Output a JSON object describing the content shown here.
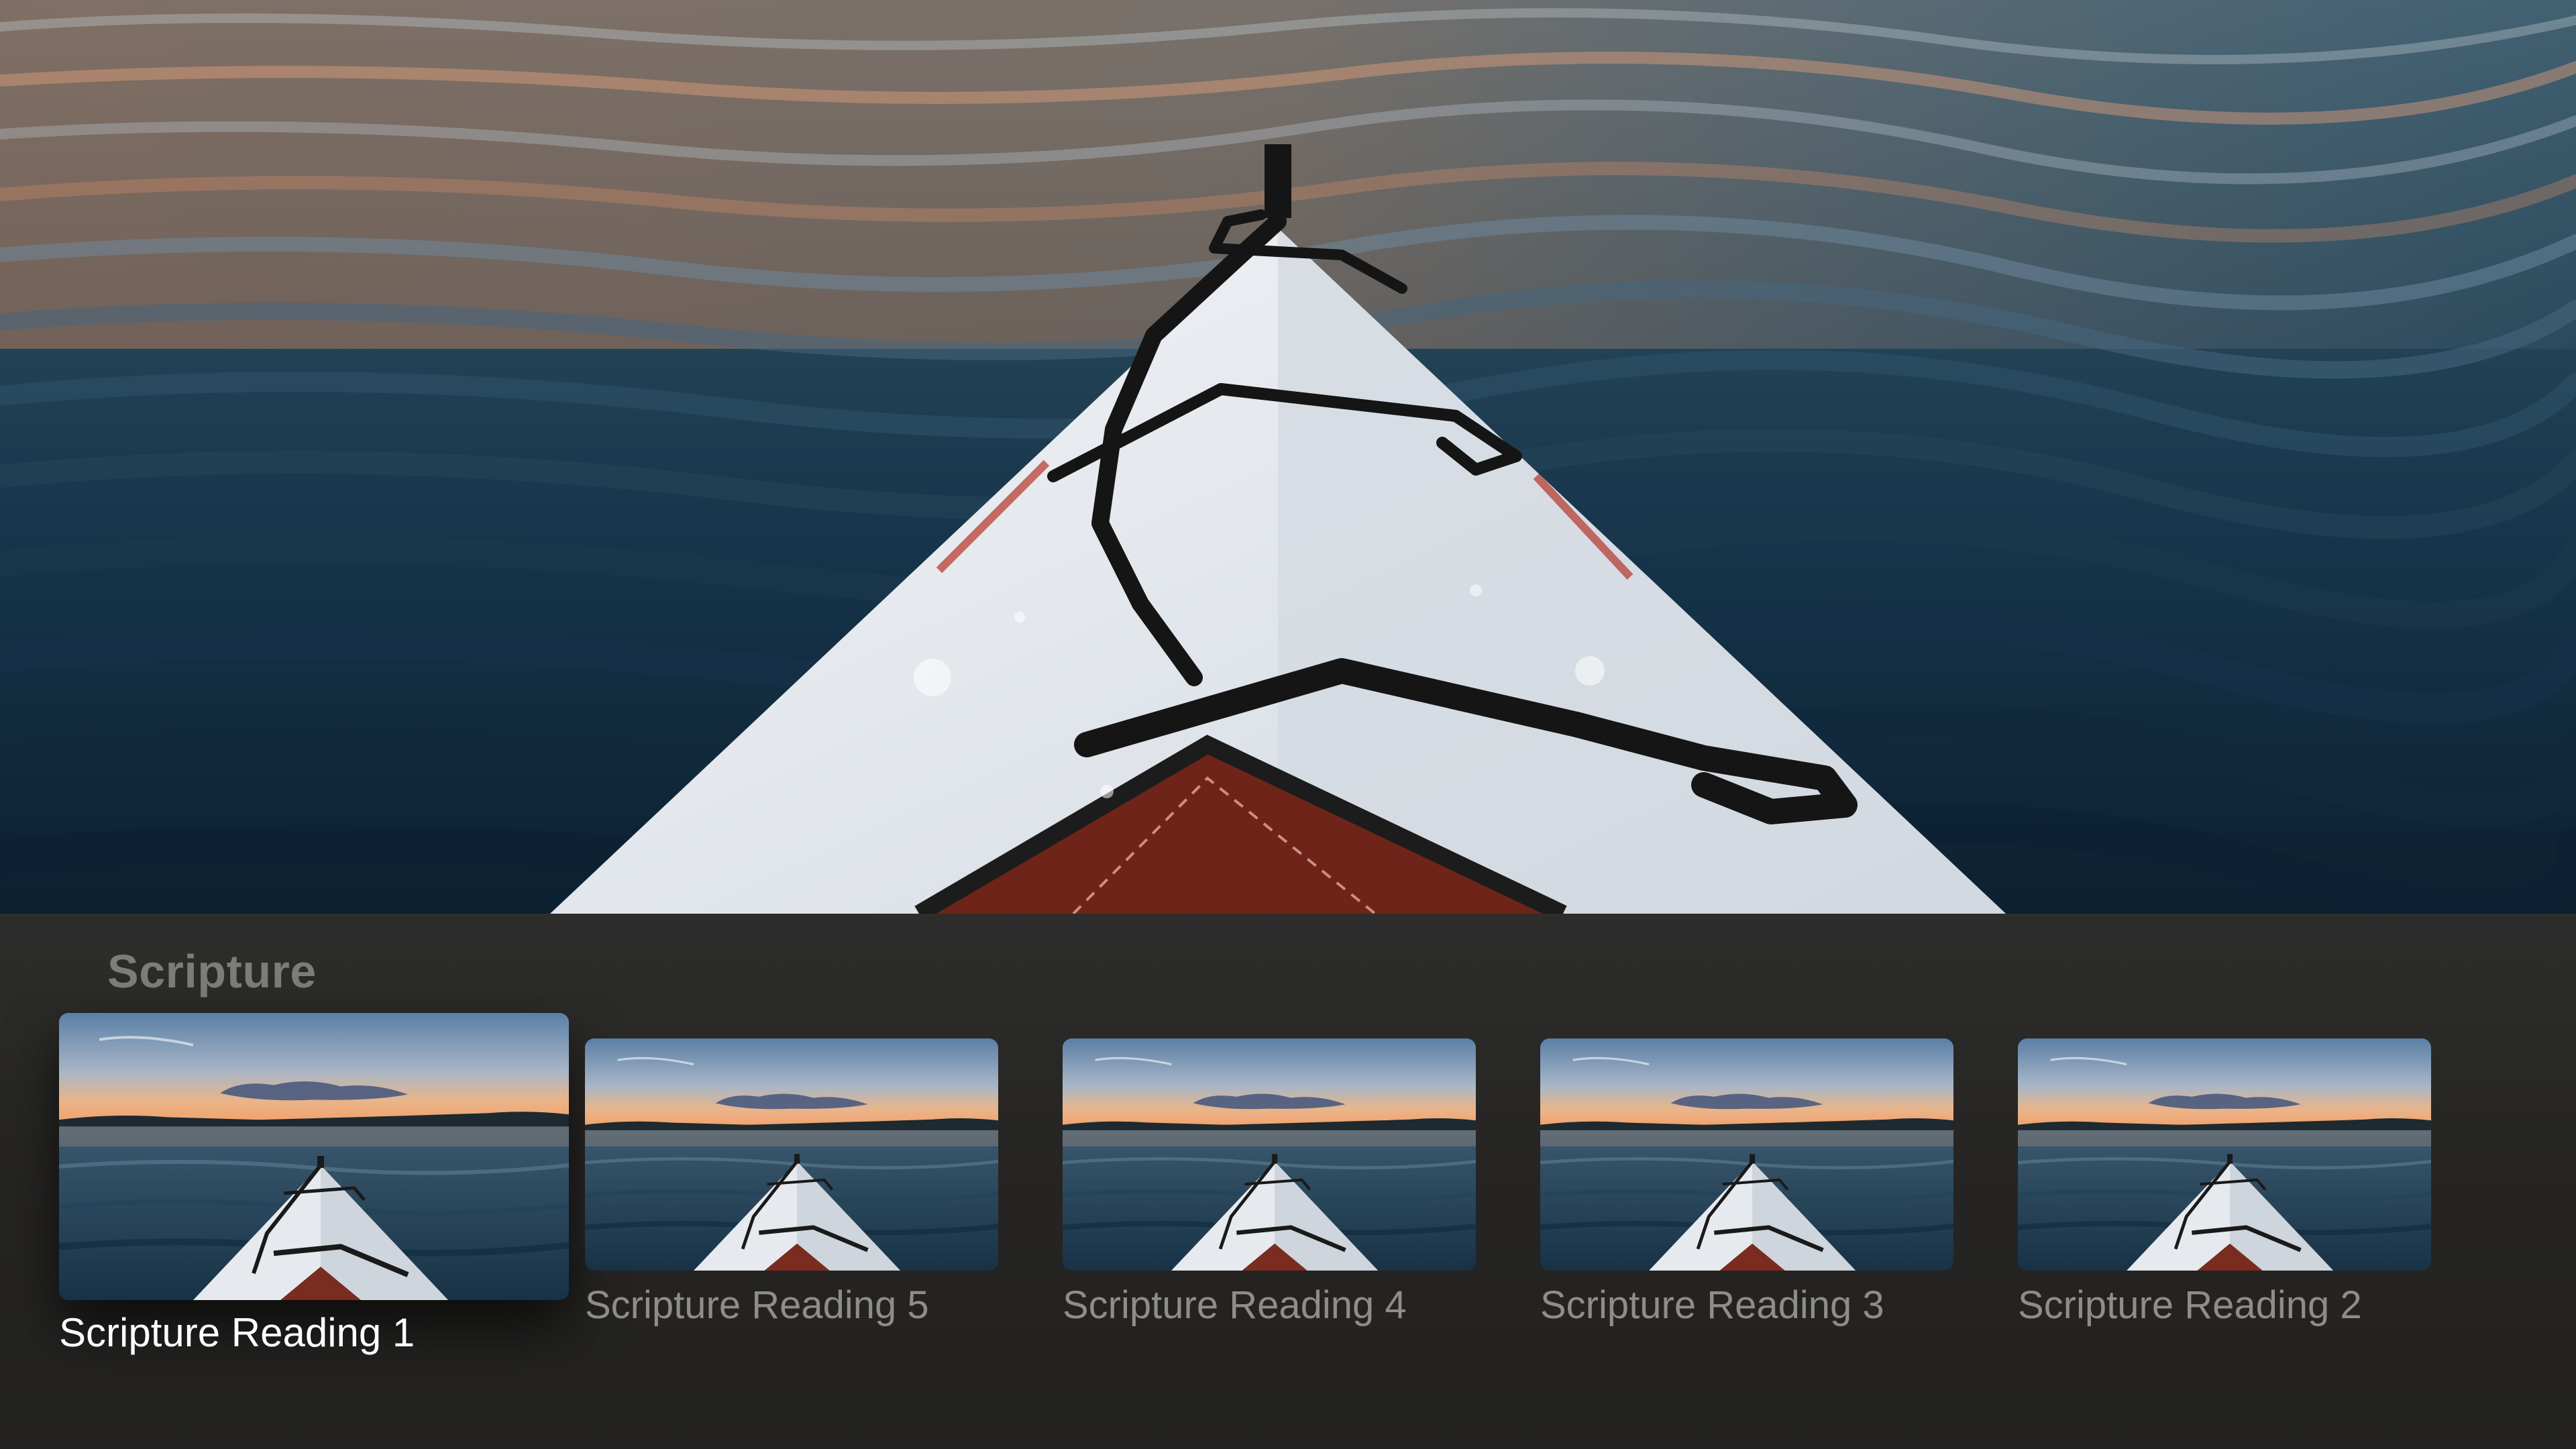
{
  "hero": {
    "image": "kayak-bow-on-water-photo"
  },
  "shelf": {
    "title": "Scripture",
    "items": [
      {
        "label": "Scripture Reading 1",
        "focused": true
      },
      {
        "label": "Scripture Reading 5",
        "focused": false
      },
      {
        "label": "Scripture Reading 4",
        "focused": false
      },
      {
        "label": "Scripture Reading 3",
        "focused": false
      },
      {
        "label": "Scripture Reading 2",
        "focused": false
      }
    ]
  },
  "colors": {
    "shelf_background": "#262523",
    "title_text": "#7d7c79",
    "label_text": "#8e8d8a",
    "focused_label_text": "#ffffff",
    "water_dark": "#102a3a",
    "kayak_hull": "#e4e8ee"
  }
}
